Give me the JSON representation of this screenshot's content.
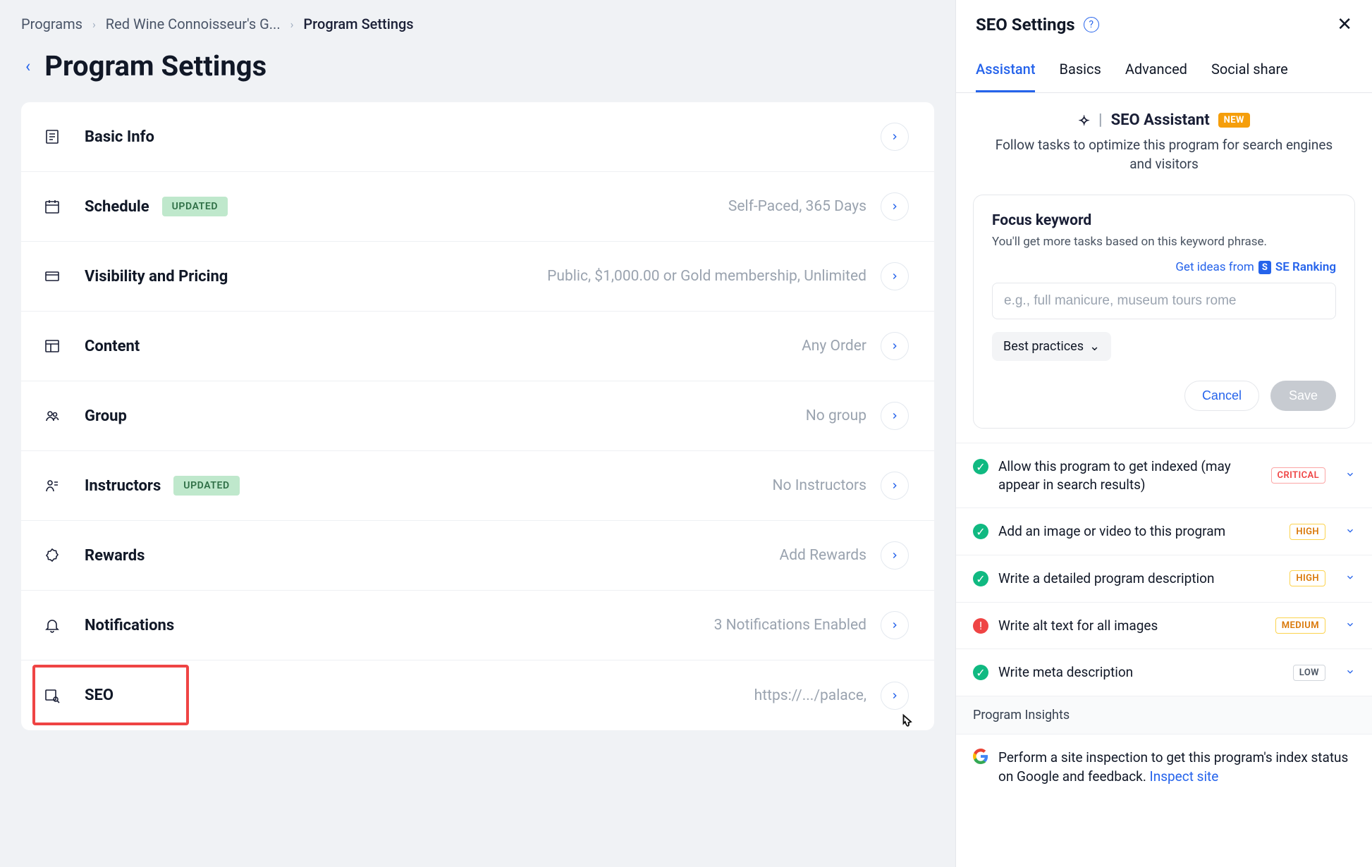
{
  "breadcrumb": {
    "c1": "Programs",
    "c2": "Red Wine Connoisseur's G...",
    "c3": "Program Settings"
  },
  "pageTitle": "Program Settings",
  "rows": {
    "basicInfo": {
      "label": "Basic Info"
    },
    "schedule": {
      "label": "Schedule",
      "badge": "UPDATED",
      "summary": "Self-Paced, 365 Days"
    },
    "visibility": {
      "label": "Visibility and Pricing",
      "summary": "Public, $1,000.00 or Gold membership, Unlimited"
    },
    "content": {
      "label": "Content",
      "summary": "Any Order"
    },
    "group": {
      "label": "Group",
      "summary": "No group"
    },
    "instructors": {
      "label": "Instructors",
      "badge": "UPDATED",
      "summary": "No Instructors"
    },
    "rewards": {
      "label": "Rewards",
      "summary": "Add Rewards"
    },
    "notifications": {
      "label": "Notifications",
      "summary": "3 Notifications Enabled"
    },
    "seo": {
      "label": "SEO",
      "summary": "https://.../palace,"
    }
  },
  "panel": {
    "title": "SEO Settings",
    "tabs": {
      "assistant": "Assistant",
      "basics": "Basics",
      "advanced": "Advanced",
      "social": "Social share"
    },
    "assistant": {
      "heading": "SEO Assistant",
      "newChip": "NEW",
      "subheading": "Follow tasks to optimize this program for search engines and visitors"
    },
    "focus": {
      "title": "Focus keyword",
      "hint": "You'll get more tasks based on this keyword phrase.",
      "seLinkPrefix": "Get ideas from",
      "seLinkName": "SE Ranking",
      "placeholder": "e.g., full manicure, museum tours rome",
      "bestPractices": "Best practices",
      "cancel": "Cancel",
      "save": "Save"
    },
    "tasks": [
      {
        "status": "ok",
        "text": "Allow this program to get indexed (may appear in search results)",
        "prio": "CRITICAL",
        "prioClass": "critical"
      },
      {
        "status": "ok",
        "text": "Add an image or video to this program",
        "prio": "HIGH",
        "prioClass": "high"
      },
      {
        "status": "ok",
        "text": "Write a detailed program description",
        "prio": "HIGH",
        "prioClass": "high"
      },
      {
        "status": "err",
        "text": "Write alt text for all images",
        "prio": "MEDIUM",
        "prioClass": "medium"
      },
      {
        "status": "ok",
        "text": "Write meta description",
        "prio": "LOW",
        "prioClass": "low"
      }
    ],
    "insightsHead": "Program Insights",
    "insightText": "Perform a site inspection to get this program's index status on Google and feedback. ",
    "insightLink": "Inspect site"
  }
}
